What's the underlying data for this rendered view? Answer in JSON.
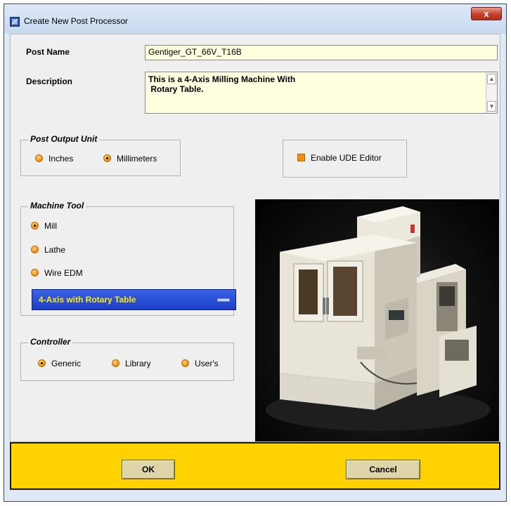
{
  "window": {
    "title": "Create New Post Processor",
    "close_glyph": "x"
  },
  "post_name": {
    "label": "Post Name",
    "value": "Gentiger_GT_66V_T16B"
  },
  "description": {
    "label": "Description",
    "line1": "This is a 4-Axis Milling Machine With",
    "line2": " Rotary Table."
  },
  "post_output_unit": {
    "legend": "Post Output Unit",
    "options": [
      "Inches",
      "Millimeters"
    ],
    "selected": "Millimeters"
  },
  "enable_ude": {
    "label": "Enable UDE Editor",
    "checked": true
  },
  "machine_tool": {
    "legend": "Machine Tool",
    "options": [
      "Mill",
      "Lathe",
      "Wire EDM"
    ],
    "selected": "Mill",
    "dropdown_value": "4-Axis with Rotary Table"
  },
  "controller": {
    "legend": "Controller",
    "options": [
      "Generic",
      "Library",
      "User's"
    ],
    "selected": "Generic"
  },
  "buttons": {
    "ok": "OK",
    "cancel": "Cancel"
  },
  "colors": {
    "accent_orange": "#e88a00",
    "field_bg": "#ffffe0",
    "dropdown_blue": "#1c3dc8",
    "dropdown_text": "#ffeb00",
    "footer_yellow": "#ffd200"
  },
  "icons": {
    "app": "post-builder-icon",
    "close": "close-icon",
    "radio": "radio-icon",
    "checkbox": "checkbox-icon"
  }
}
